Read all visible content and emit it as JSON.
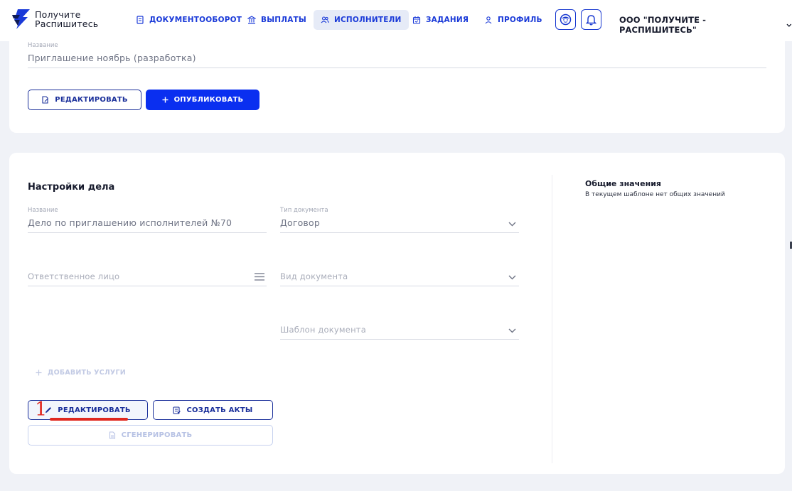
{
  "header": {
    "logo_text_line1": "Получите",
    "logo_text_line2": "Распишитесь",
    "nav": [
      {
        "label": "ДОКУМЕНТООБОРОТ",
        "icon": "document-icon",
        "active": false
      },
      {
        "label": "ВЫПЛАТЫ",
        "icon": "bank-icon",
        "active": false
      },
      {
        "label": "ИСПОЛНИТЕЛИ",
        "icon": "users-icon",
        "active": true
      },
      {
        "label": "ЗАДАНИЯ",
        "icon": "calendar-icon",
        "active": false
      },
      {
        "label": "ПРОФИЛЬ",
        "icon": "user-icon",
        "active": false
      }
    ],
    "support_icon": "support-face-icon",
    "notification_icon": "bell-icon",
    "org_name": "ООО \"ПОЛУЧИТЕ - РАСПИШИТЕСЬ\""
  },
  "invitation": {
    "name_label": "Название",
    "name_value": "Приглашение ноябрь (разработка)",
    "edit_label": "РЕДАКТИРОВАТЬ",
    "publish_label": "ОПУБЛИКОВАТЬ"
  },
  "case_settings": {
    "title": "Настройки дела",
    "name_label": "Название",
    "name_value": "Дело по приглашению исполнителей №70",
    "doc_type_label": "Тип документа",
    "doc_type_value": "Договор",
    "responsible_placeholder": "Ответственное лицо",
    "doc_kind_placeholder": "Вид документа",
    "template_placeholder": "Шаблон документа",
    "add_services_label": "ДОБАВИТЬ УСЛУГИ",
    "edit_label": "РЕДАКТИРОВАТЬ",
    "create_acts_label": "СОЗДАТЬ АКТЫ",
    "generate_label": "СГЕНЕРИРОВАТЬ"
  },
  "common_values": {
    "title": "Общие значения",
    "text": "В текущем шаблоне нет общих значений"
  },
  "annotation": {
    "number": "1"
  },
  "colors": {
    "accent": "#0a2ff0",
    "nav_text": "#1a3ad8",
    "annotation": "#e0281f"
  }
}
